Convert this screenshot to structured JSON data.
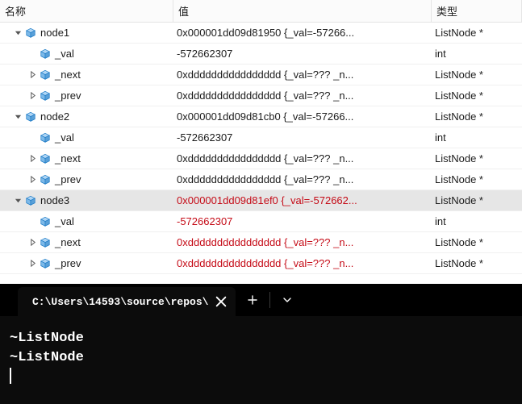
{
  "headers": {
    "name": "名称",
    "value": "值",
    "type": "类型"
  },
  "rows": [
    {
      "indent": 0,
      "expander": "down",
      "label": "node1",
      "value": "0x000001dd09d81950 {_val=-57266...",
      "type": "ListNode *",
      "red": false,
      "selected": false
    },
    {
      "indent": 1,
      "expander": "none",
      "label": "_val",
      "value": "-572662307",
      "type": "int",
      "red": false,
      "selected": false
    },
    {
      "indent": 1,
      "expander": "right",
      "label": "_next",
      "value": "0xdddddddddddddddd {_val=??? _n...",
      "type": "ListNode *",
      "red": false,
      "selected": false
    },
    {
      "indent": 1,
      "expander": "right",
      "label": "_prev",
      "value": "0xdddddddddddddddd {_val=??? _n...",
      "type": "ListNode *",
      "red": false,
      "selected": false
    },
    {
      "indent": 0,
      "expander": "down",
      "label": "node2",
      "value": "0x000001dd09d81cb0 {_val=-57266...",
      "type": "ListNode *",
      "red": false,
      "selected": false
    },
    {
      "indent": 1,
      "expander": "none",
      "label": "_val",
      "value": "-572662307",
      "type": "int",
      "red": false,
      "selected": false
    },
    {
      "indent": 1,
      "expander": "right",
      "label": "_next",
      "value": "0xdddddddddddddddd {_val=??? _n...",
      "type": "ListNode *",
      "red": false,
      "selected": false
    },
    {
      "indent": 1,
      "expander": "right",
      "label": "_prev",
      "value": "0xdddddddddddddddd {_val=??? _n...",
      "type": "ListNode *",
      "red": false,
      "selected": false
    },
    {
      "indent": 0,
      "expander": "down",
      "label": "node3",
      "value": "0x000001dd09d81ef0 {_val=-572662...",
      "type": "ListNode *",
      "red": true,
      "selected": true
    },
    {
      "indent": 1,
      "expander": "none",
      "label": "_val",
      "value": "-572662307",
      "type": "int",
      "red": true,
      "selected": false
    },
    {
      "indent": 1,
      "expander": "right",
      "label": "_next",
      "value": "0xdddddddddddddddd {_val=??? _n...",
      "type": "ListNode *",
      "red": true,
      "selected": false
    },
    {
      "indent": 1,
      "expander": "right",
      "label": "_prev",
      "value": "0xdddddddddddddddd {_val=??? _n...",
      "type": "ListNode *",
      "red": true,
      "selected": false
    }
  ],
  "terminal": {
    "tab_title": "C:\\Users\\14593\\source\\repos\\",
    "lines": [
      "~ListNode",
      "~ListNode"
    ]
  }
}
